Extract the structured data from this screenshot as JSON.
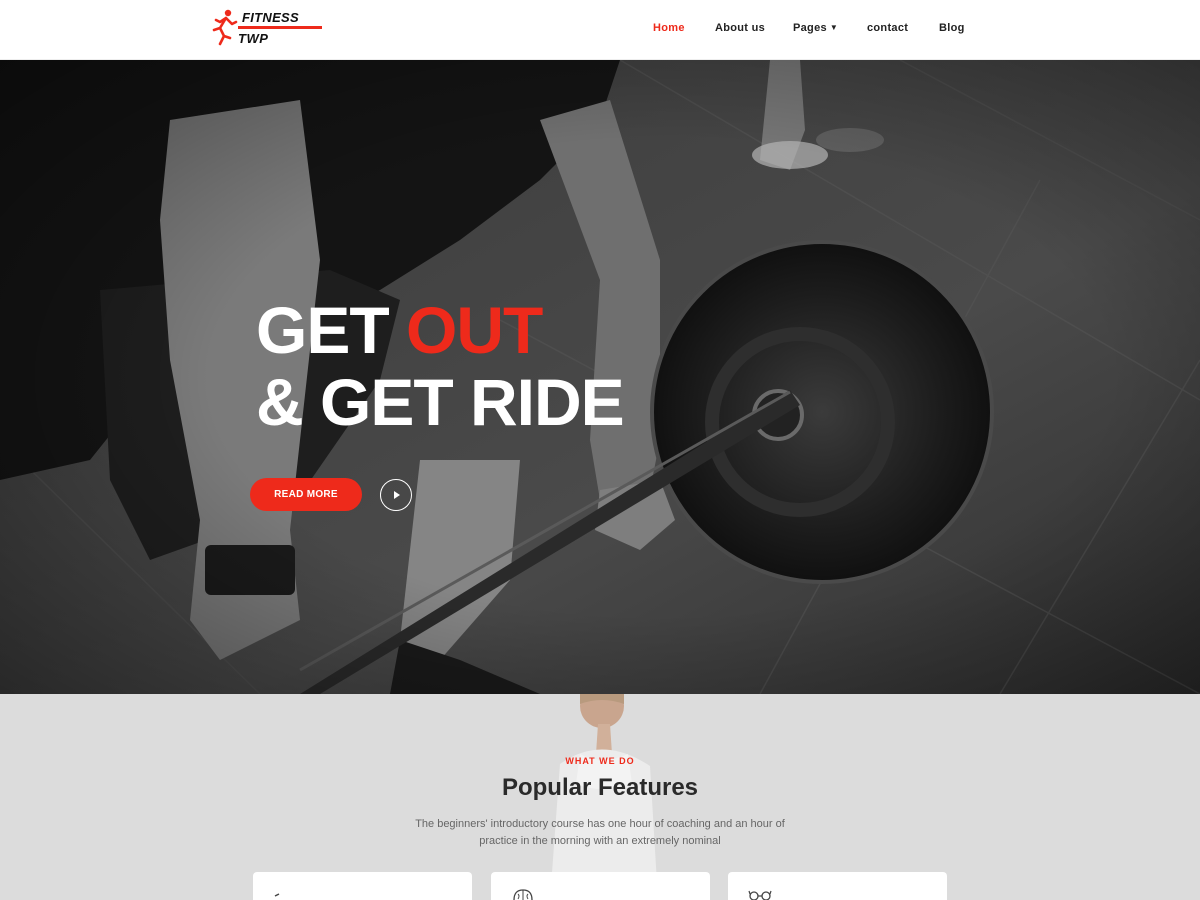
{
  "header": {
    "logo": {
      "line1": "FITNESS",
      "line2": "TWP",
      "icon": "runner-icon"
    },
    "nav": [
      {
        "label": "Home",
        "active": true
      },
      {
        "label": "About us",
        "active": false
      },
      {
        "label": "Pages",
        "active": false,
        "dropdown": true
      },
      {
        "label": "contact",
        "active": false
      },
      {
        "label": "Blog",
        "active": false
      }
    ]
  },
  "hero": {
    "line1_white": "GET",
    "line1_accent": "OUT",
    "line2": "& GET RIDE",
    "button_label": "READ MORE",
    "play_icon": "play-icon"
  },
  "features": {
    "eyebrow": "WHAT WE DO",
    "title": "Popular Features",
    "description": "The beginners' introductory course has one hour of coaching and an hour of practice in the morning with an extremely nominal",
    "card_icons": [
      "dumbbell-icon",
      "brain-icon",
      "glasses-icon"
    ]
  },
  "colors": {
    "accent": "#ee2a1b",
    "dark_text": "#2a2a2a",
    "section_bg": "#dcdcdc"
  }
}
